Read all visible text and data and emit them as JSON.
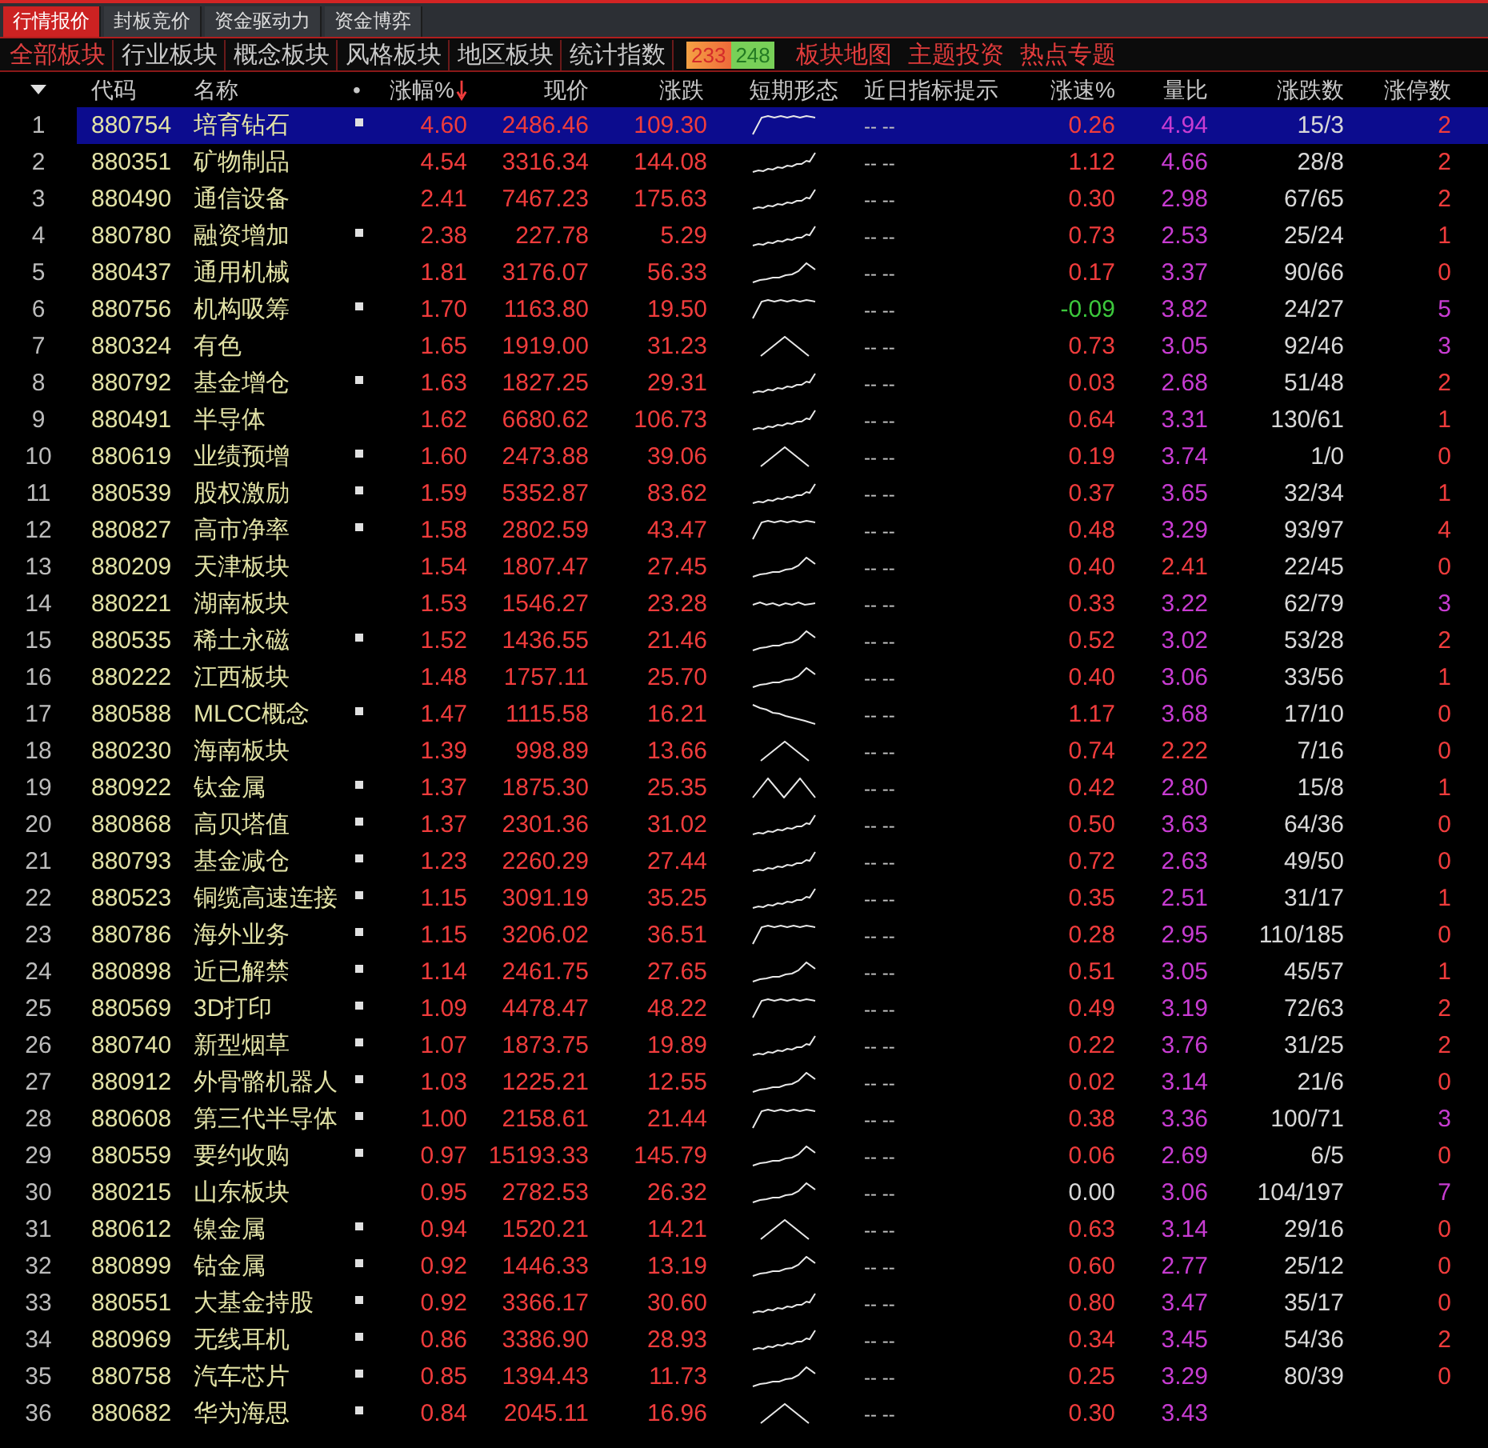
{
  "top_tabs": [
    {
      "label": "行情报价",
      "selected": true
    },
    {
      "label": "封板竞价",
      "selected": false
    },
    {
      "label": "资金驱动力",
      "selected": false
    },
    {
      "label": "资金博弈",
      "selected": false
    }
  ],
  "sector_tabs": [
    {
      "label": "全部板块",
      "selected": true
    },
    {
      "label": "行业板块",
      "selected": false
    },
    {
      "label": "概念板块",
      "selected": false
    },
    {
      "label": "风格板块",
      "selected": false
    },
    {
      "label": "地区板块",
      "selected": false
    },
    {
      "label": "统计指数",
      "selected": false
    }
  ],
  "counters": [
    {
      "text": "233",
      "kind": "up"
    },
    {
      "text": "248",
      "kind": "down"
    }
  ],
  "links": [
    "板块地图",
    "主题投资",
    "热点专题"
  ],
  "table": {
    "columns": [
      {
        "label": "代码",
        "sorted": false
      },
      {
        "label": "名称",
        "sorted": false
      },
      {
        "label": "•",
        "sorted": false
      },
      {
        "label": "涨幅%",
        "sorted": true
      },
      {
        "label": "现价",
        "sorted": false
      },
      {
        "label": "涨跌",
        "sorted": false
      },
      {
        "label": "短期形态",
        "sorted": false
      },
      {
        "label": "近日指标提示",
        "sorted": false
      },
      {
        "label": "涨速%",
        "sorted": false
      },
      {
        "label": "量比",
        "sorted": false
      },
      {
        "label": "涨跌数",
        "sorted": false
      },
      {
        "label": "涨停数",
        "sorted": false
      }
    ],
    "rows": [
      {
        "no": "1",
        "code": "880754",
        "name": "培育钻石",
        "marked": true,
        "color": "#f03c3c",
        "change_pct": "4.60",
        "price": "2486.46",
        "change": "109.30",
        "sparkline": {
          "kind": "plateau"
        },
        "hint": "-- --",
        "speed": {
          "text": "0.26",
          "color": "#f03c3c"
        },
        "volume_ratio": {
          "text": "4.94",
          "color": "#c83cd2"
        },
        "up_down": "15/3",
        "limit_up": {
          "text": "2",
          "color": "#f03c3c"
        },
        "selected": true
      },
      {
        "no": "2",
        "code": "880351",
        "name": "矿物制品",
        "marked": false,
        "color": "#f03c3c",
        "change_pct": "4.54",
        "price": "3316.34",
        "change": "144.08",
        "sparkline": {
          "kind": "rising"
        },
        "hint": "-- --",
        "speed": {
          "text": "1.12",
          "color": "#f03c3c"
        },
        "volume_ratio": {
          "text": "4.66",
          "color": "#c83cd2"
        },
        "up_down": "28/8",
        "limit_up": {
          "text": "2",
          "color": "#f03c3c"
        },
        "selected": false
      },
      {
        "no": "3",
        "code": "880490",
        "name": "通信设备",
        "marked": false,
        "color": "#f03c3c",
        "change_pct": "2.41",
        "price": "7467.23",
        "change": "175.63",
        "sparkline": {
          "kind": "rising"
        },
        "hint": "-- --",
        "speed": {
          "text": "0.30",
          "color": "#f03c3c"
        },
        "volume_ratio": {
          "text": "2.98",
          "color": "#c83cd2"
        },
        "up_down": "67/65",
        "limit_up": {
          "text": "2",
          "color": "#f03c3c"
        },
        "selected": false
      },
      {
        "no": "4",
        "code": "880780",
        "name": "融资增加",
        "marked": true,
        "color": "#f03c3c",
        "change_pct": "2.38",
        "price": "227.78",
        "change": "5.29",
        "sparkline": {
          "kind": "rising"
        },
        "hint": "-- --",
        "speed": {
          "text": "0.73",
          "color": "#f03c3c"
        },
        "volume_ratio": {
          "text": "2.53",
          "color": "#c83cd2"
        },
        "up_down": "25/24",
        "limit_up": {
          "text": "1",
          "color": "#f03c3c"
        },
        "selected": false
      },
      {
        "no": "5",
        "code": "880437",
        "name": "通用机械",
        "marked": false,
        "color": "#f03c3c",
        "change_pct": "1.81",
        "price": "3176.07",
        "change": "56.33",
        "sparkline": {
          "kind": "hump"
        },
        "hint": "-- --",
        "speed": {
          "text": "0.17",
          "color": "#f03c3c"
        },
        "volume_ratio": {
          "text": "3.37",
          "color": "#c83cd2"
        },
        "up_down": "90/66",
        "limit_up": {
          "text": "0",
          "color": "#f03c3c"
        },
        "selected": false
      },
      {
        "no": "6",
        "code": "880756",
        "name": "机构吸筹",
        "marked": true,
        "color": "#f03c3c",
        "change_pct": "1.70",
        "price": "1163.80",
        "change": "19.50",
        "sparkline": {
          "kind": "plateau"
        },
        "hint": "-- --",
        "speed": {
          "text": "-0.09",
          "color": "#3cc83c"
        },
        "volume_ratio": {
          "text": "3.82",
          "color": "#c83cd2"
        },
        "up_down": "24/27",
        "limit_up": {
          "text": "5",
          "color": "#c83cd2"
        },
        "selected": false
      },
      {
        "no": "7",
        "code": "880324",
        "name": "有色",
        "marked": false,
        "color": "#f03c3c",
        "change_pct": "1.65",
        "price": "1919.00",
        "change": "31.23",
        "sparkline": {
          "kind": "peak"
        },
        "hint": "-- --",
        "speed": {
          "text": "0.73",
          "color": "#f03c3c"
        },
        "volume_ratio": {
          "text": "3.05",
          "color": "#c83cd2"
        },
        "up_down": "92/46",
        "limit_up": {
          "text": "3",
          "color": "#c83cd2"
        },
        "selected": false
      },
      {
        "no": "8",
        "code": "880792",
        "name": "基金增仓",
        "marked": true,
        "color": "#f03c3c",
        "change_pct": "1.63",
        "price": "1827.25",
        "change": "29.31",
        "sparkline": {
          "kind": "rising"
        },
        "hint": "-- --",
        "speed": {
          "text": "0.03",
          "color": "#f03c3c"
        },
        "volume_ratio": {
          "text": "2.68",
          "color": "#c83cd2"
        },
        "up_down": "51/48",
        "limit_up": {
          "text": "2",
          "color": "#f03c3c"
        },
        "selected": false
      },
      {
        "no": "9",
        "code": "880491",
        "name": "半导体",
        "marked": false,
        "color": "#f03c3c",
        "change_pct": "1.62",
        "price": "6680.62",
        "change": "106.73",
        "sparkline": {
          "kind": "rising"
        },
        "hint": "-- --",
        "speed": {
          "text": "0.64",
          "color": "#f03c3c"
        },
        "volume_ratio": {
          "text": "3.31",
          "color": "#c83cd2"
        },
        "up_down": "130/61",
        "limit_up": {
          "text": "1",
          "color": "#f03c3c"
        },
        "selected": false
      },
      {
        "no": "10",
        "code": "880619",
        "name": "业绩预增",
        "marked": true,
        "color": "#f03c3c",
        "change_pct": "1.60",
        "price": "2473.88",
        "change": "39.06",
        "sparkline": {
          "kind": "peak"
        },
        "hint": "-- --",
        "speed": {
          "text": "0.19",
          "color": "#f03c3c"
        },
        "volume_ratio": {
          "text": "3.74",
          "color": "#c83cd2"
        },
        "up_down": "1/0",
        "limit_up": {
          "text": "0",
          "color": "#f03c3c"
        },
        "selected": false
      },
      {
        "no": "11",
        "code": "880539",
        "name": "股权激励",
        "marked": true,
        "color": "#f03c3c",
        "change_pct": "1.59",
        "price": "5352.87",
        "change": "83.62",
        "sparkline": {
          "kind": "rising"
        },
        "hint": "-- --",
        "speed": {
          "text": "0.37",
          "color": "#f03c3c"
        },
        "volume_ratio": {
          "text": "3.65",
          "color": "#c83cd2"
        },
        "up_down": "32/34",
        "limit_up": {
          "text": "1",
          "color": "#f03c3c"
        },
        "selected": false
      },
      {
        "no": "12",
        "code": "880827",
        "name": "高市净率",
        "marked": true,
        "color": "#f03c3c",
        "change_pct": "1.58",
        "price": "2802.59",
        "change": "43.47",
        "sparkline": {
          "kind": "plateau"
        },
        "hint": "-- --",
        "speed": {
          "text": "0.48",
          "color": "#f03c3c"
        },
        "volume_ratio": {
          "text": "3.29",
          "color": "#c83cd2"
        },
        "up_down": "93/97",
        "limit_up": {
          "text": "4",
          "color": "#f03c3c"
        },
        "selected": false
      },
      {
        "no": "13",
        "code": "880209",
        "name": "天津板块",
        "marked": false,
        "color": "#f03c3c",
        "change_pct": "1.54",
        "price": "1807.47",
        "change": "27.45",
        "sparkline": {
          "kind": "hump"
        },
        "hint": "-- --",
        "speed": {
          "text": "0.40",
          "color": "#f03c3c"
        },
        "volume_ratio": {
          "text": "2.41",
          "color": "#f03c3c"
        },
        "up_down": "22/45",
        "limit_up": {
          "text": "0",
          "color": "#f03c3c"
        },
        "selected": false
      },
      {
        "no": "14",
        "code": "880221",
        "name": "湖南板块",
        "marked": false,
        "color": "#f03c3c",
        "change_pct": "1.53",
        "price": "1546.27",
        "change": "23.28",
        "sparkline": {
          "kind": "flat"
        },
        "hint": "-- --",
        "speed": {
          "text": "0.33",
          "color": "#f03c3c"
        },
        "volume_ratio": {
          "text": "3.22",
          "color": "#c83cd2"
        },
        "up_down": "62/79",
        "limit_up": {
          "text": "3",
          "color": "#c83cd2"
        },
        "selected": false
      },
      {
        "no": "15",
        "code": "880535",
        "name": "稀土永磁",
        "marked": true,
        "color": "#f03c3c",
        "change_pct": "1.52",
        "price": "1436.55",
        "change": "21.46",
        "sparkline": {
          "kind": "hump"
        },
        "hint": "-- --",
        "speed": {
          "text": "0.52",
          "color": "#f03c3c"
        },
        "volume_ratio": {
          "text": "3.02",
          "color": "#c83cd2"
        },
        "up_down": "53/28",
        "limit_up": {
          "text": "2",
          "color": "#f03c3c"
        },
        "selected": false
      },
      {
        "no": "16",
        "code": "880222",
        "name": "江西板块",
        "marked": false,
        "color": "#f03c3c",
        "change_pct": "1.48",
        "price": "1757.11",
        "change": "25.70",
        "sparkline": {
          "kind": "hump"
        },
        "hint": "-- --",
        "speed": {
          "text": "0.40",
          "color": "#f03c3c"
        },
        "volume_ratio": {
          "text": "3.06",
          "color": "#c83cd2"
        },
        "up_down": "33/56",
        "limit_up": {
          "text": "1",
          "color": "#f03c3c"
        },
        "selected": false
      },
      {
        "no": "17",
        "code": "880588",
        "name": "MLCC概念",
        "marked": true,
        "color": "#f03c3c",
        "change_pct": "1.47",
        "price": "1115.58",
        "change": "16.21",
        "sparkline": {
          "kind": "falling"
        },
        "hint": "-- --",
        "speed": {
          "text": "1.17",
          "color": "#f03c3c"
        },
        "volume_ratio": {
          "text": "3.68",
          "color": "#c83cd2"
        },
        "up_down": "17/10",
        "limit_up": {
          "text": "0",
          "color": "#f03c3c"
        },
        "selected": false
      },
      {
        "no": "18",
        "code": "880230",
        "name": "海南板块",
        "marked": false,
        "color": "#f03c3c",
        "change_pct": "1.39",
        "price": "998.89",
        "change": "13.66",
        "sparkline": {
          "kind": "peak"
        },
        "hint": "-- --",
        "speed": {
          "text": "0.74",
          "color": "#f03c3c"
        },
        "volume_ratio": {
          "text": "2.22",
          "color": "#f03c3c"
        },
        "up_down": "7/16",
        "limit_up": {
          "text": "0",
          "color": "#f03c3c"
        },
        "selected": false
      },
      {
        "no": "19",
        "code": "880922",
        "name": "钛金属",
        "marked": true,
        "color": "#f03c3c",
        "change_pct": "1.37",
        "price": "1875.30",
        "change": "25.35",
        "sparkline": {
          "kind": "double_peak"
        },
        "hint": "-- --",
        "speed": {
          "text": "0.42",
          "color": "#f03c3c"
        },
        "volume_ratio": {
          "text": "2.80",
          "color": "#c83cd2"
        },
        "up_down": "15/8",
        "limit_up": {
          "text": "1",
          "color": "#f03c3c"
        },
        "selected": false
      },
      {
        "no": "20",
        "code": "880868",
        "name": "高贝塔值",
        "marked": true,
        "color": "#f03c3c",
        "change_pct": "1.37",
        "price": "2301.36",
        "change": "31.02",
        "sparkline": {
          "kind": "rising"
        },
        "hint": "-- --",
        "speed": {
          "text": "0.50",
          "color": "#f03c3c"
        },
        "volume_ratio": {
          "text": "3.63",
          "color": "#c83cd2"
        },
        "up_down": "64/36",
        "limit_up": {
          "text": "0",
          "color": "#f03c3c"
        },
        "selected": false
      },
      {
        "no": "21",
        "code": "880793",
        "name": "基金减仓",
        "marked": true,
        "color": "#f03c3c",
        "change_pct": "1.23",
        "price": "2260.29",
        "change": "27.44",
        "sparkline": {
          "kind": "rising"
        },
        "hint": "-- --",
        "speed": {
          "text": "0.72",
          "color": "#f03c3c"
        },
        "volume_ratio": {
          "text": "2.63",
          "color": "#c83cd2"
        },
        "up_down": "49/50",
        "limit_up": {
          "text": "0",
          "color": "#f03c3c"
        },
        "selected": false
      },
      {
        "no": "22",
        "code": "880523",
        "name": "铜缆高速连接",
        "marked": true,
        "color": "#f03c3c",
        "change_pct": "1.15",
        "price": "3091.19",
        "change": "35.25",
        "sparkline": {
          "kind": "rising"
        },
        "hint": "-- --",
        "speed": {
          "text": "0.35",
          "color": "#f03c3c"
        },
        "volume_ratio": {
          "text": "2.51",
          "color": "#c83cd2"
        },
        "up_down": "31/17",
        "limit_up": {
          "text": "1",
          "color": "#f03c3c"
        },
        "selected": false
      },
      {
        "no": "23",
        "code": "880786",
        "name": "海外业务",
        "marked": true,
        "color": "#f03c3c",
        "change_pct": "1.15",
        "price": "3206.02",
        "change": "36.51",
        "sparkline": {
          "kind": "plateau"
        },
        "hint": "-- --",
        "speed": {
          "text": "0.28",
          "color": "#f03c3c"
        },
        "volume_ratio": {
          "text": "2.95",
          "color": "#c83cd2"
        },
        "up_down": "110/185",
        "limit_up": {
          "text": "0",
          "color": "#f03c3c"
        },
        "selected": false
      },
      {
        "no": "24",
        "code": "880898",
        "name": "近已解禁",
        "marked": true,
        "color": "#f03c3c",
        "change_pct": "1.14",
        "price": "2461.75",
        "change": "27.65",
        "sparkline": {
          "kind": "hump"
        },
        "hint": "-- --",
        "speed": {
          "text": "0.51",
          "color": "#f03c3c"
        },
        "volume_ratio": {
          "text": "3.05",
          "color": "#c83cd2"
        },
        "up_down": "45/57",
        "limit_up": {
          "text": "1",
          "color": "#f03c3c"
        },
        "selected": false
      },
      {
        "no": "25",
        "code": "880569",
        "name": "3D打印",
        "marked": true,
        "color": "#f03c3c",
        "change_pct": "1.09",
        "price": "4478.47",
        "change": "48.22",
        "sparkline": {
          "kind": "plateau"
        },
        "hint": "-- --",
        "speed": {
          "text": "0.49",
          "color": "#f03c3c"
        },
        "volume_ratio": {
          "text": "3.19",
          "color": "#c83cd2"
        },
        "up_down": "72/63",
        "limit_up": {
          "text": "2",
          "color": "#f03c3c"
        },
        "selected": false
      },
      {
        "no": "26",
        "code": "880740",
        "name": "新型烟草",
        "marked": true,
        "color": "#f03c3c",
        "change_pct": "1.07",
        "price": "1873.75",
        "change": "19.89",
        "sparkline": {
          "kind": "rising"
        },
        "hint": "-- --",
        "speed": {
          "text": "0.22",
          "color": "#f03c3c"
        },
        "volume_ratio": {
          "text": "3.76",
          "color": "#c83cd2"
        },
        "up_down": "31/25",
        "limit_up": {
          "text": "2",
          "color": "#f03c3c"
        },
        "selected": false
      },
      {
        "no": "27",
        "code": "880912",
        "name": "外骨骼机器人",
        "marked": true,
        "color": "#f03c3c",
        "change_pct": "1.03",
        "price": "1225.21",
        "change": "12.55",
        "sparkline": {
          "kind": "hump"
        },
        "hint": "-- --",
        "speed": {
          "text": "0.02",
          "color": "#f03c3c"
        },
        "volume_ratio": {
          "text": "3.14",
          "color": "#c83cd2"
        },
        "up_down": "21/6",
        "limit_up": {
          "text": "0",
          "color": "#f03c3c"
        },
        "selected": false
      },
      {
        "no": "28",
        "code": "880608",
        "name": "第三代半导体",
        "marked": true,
        "color": "#f03c3c",
        "change_pct": "1.00",
        "price": "2158.61",
        "change": "21.44",
        "sparkline": {
          "kind": "plateau"
        },
        "hint": "-- --",
        "speed": {
          "text": "0.38",
          "color": "#f03c3c"
        },
        "volume_ratio": {
          "text": "3.36",
          "color": "#c83cd2"
        },
        "up_down": "100/71",
        "limit_up": {
          "text": "3",
          "color": "#c83cd2"
        },
        "selected": false
      },
      {
        "no": "29",
        "code": "880559",
        "name": "要约收购",
        "marked": true,
        "color": "#f03c3c",
        "change_pct": "0.97",
        "price": "15193.33",
        "change": "145.79",
        "sparkline": {
          "kind": "hump"
        },
        "hint": "-- --",
        "speed": {
          "text": "0.06",
          "color": "#f03c3c"
        },
        "volume_ratio": {
          "text": "2.69",
          "color": "#c83cd2"
        },
        "up_down": "6/5",
        "limit_up": {
          "text": "0",
          "color": "#f03c3c"
        },
        "selected": false
      },
      {
        "no": "30",
        "code": "880215",
        "name": "山东板块",
        "marked": false,
        "color": "#f03c3c",
        "change_pct": "0.95",
        "price": "2782.53",
        "change": "26.32",
        "sparkline": {
          "kind": "hump"
        },
        "hint": "-- --",
        "speed": {
          "text": "0.00",
          "color": "#d8d8d8"
        },
        "volume_ratio": {
          "text": "3.06",
          "color": "#c83cd2"
        },
        "up_down": "104/197",
        "limit_up": {
          "text": "7",
          "color": "#c83cd2"
        },
        "selected": false
      },
      {
        "no": "31",
        "code": "880612",
        "name": "镍金属",
        "marked": true,
        "color": "#f03c3c",
        "change_pct": "0.94",
        "price": "1520.21",
        "change": "14.21",
        "sparkline": {
          "kind": "peak"
        },
        "hint": "-- --",
        "speed": {
          "text": "0.63",
          "color": "#f03c3c"
        },
        "volume_ratio": {
          "text": "3.14",
          "color": "#c83cd2"
        },
        "up_down": "29/16",
        "limit_up": {
          "text": "0",
          "color": "#f03c3c"
        },
        "selected": false
      },
      {
        "no": "32",
        "code": "880899",
        "name": "钴金属",
        "marked": true,
        "color": "#f03c3c",
        "change_pct": "0.92",
        "price": "1446.33",
        "change": "13.19",
        "sparkline": {
          "kind": "hump"
        },
        "hint": "-- --",
        "speed": {
          "text": "0.60",
          "color": "#f03c3c"
        },
        "volume_ratio": {
          "text": "2.77",
          "color": "#c83cd2"
        },
        "up_down": "25/12",
        "limit_up": {
          "text": "0",
          "color": "#f03c3c"
        },
        "selected": false
      },
      {
        "no": "33",
        "code": "880551",
        "name": "大基金持股",
        "marked": true,
        "color": "#f03c3c",
        "change_pct": "0.92",
        "price": "3366.17",
        "change": "30.60",
        "sparkline": {
          "kind": "rising"
        },
        "hint": "-- --",
        "speed": {
          "text": "0.80",
          "color": "#f03c3c"
        },
        "volume_ratio": {
          "text": "3.47",
          "color": "#c83cd2"
        },
        "up_down": "35/17",
        "limit_up": {
          "text": "0",
          "color": "#f03c3c"
        },
        "selected": false
      },
      {
        "no": "34",
        "code": "880969",
        "name": "无线耳机",
        "marked": true,
        "color": "#f03c3c",
        "change_pct": "0.86",
        "price": "3386.90",
        "change": "28.93",
        "sparkline": {
          "kind": "rising"
        },
        "hint": "-- --",
        "speed": {
          "text": "0.34",
          "color": "#f03c3c"
        },
        "volume_ratio": {
          "text": "3.45",
          "color": "#c83cd2"
        },
        "up_down": "54/36",
        "limit_up": {
          "text": "2",
          "color": "#f03c3c"
        },
        "selected": false
      },
      {
        "no": "35",
        "code": "880758",
        "name": "汽车芯片",
        "marked": true,
        "color": "#f03c3c",
        "change_pct": "0.85",
        "price": "1394.43",
        "change": "11.73",
        "sparkline": {
          "kind": "hump"
        },
        "hint": "-- --",
        "speed": {
          "text": "0.25",
          "color": "#f03c3c"
        },
        "volume_ratio": {
          "text": "3.29",
          "color": "#c83cd2"
        },
        "up_down": "80/39",
        "limit_up": {
          "text": "0",
          "color": "#f03c3c"
        },
        "selected": false
      },
      {
        "no": "36",
        "code": "880682",
        "name": "华为海思",
        "marked": true,
        "color": "#f03c3c",
        "change_pct": "0.84",
        "price": "2045.11",
        "change": "16.96",
        "sparkline": {
          "kind": "peak"
        },
        "hint": "-- --",
        "speed": {
          "text": "0.30",
          "color": "#f03c3c"
        },
        "volume_ratio": {
          "text": "3.43",
          "color": "#c83cd2"
        },
        "selected": false
      }
    ]
  }
}
